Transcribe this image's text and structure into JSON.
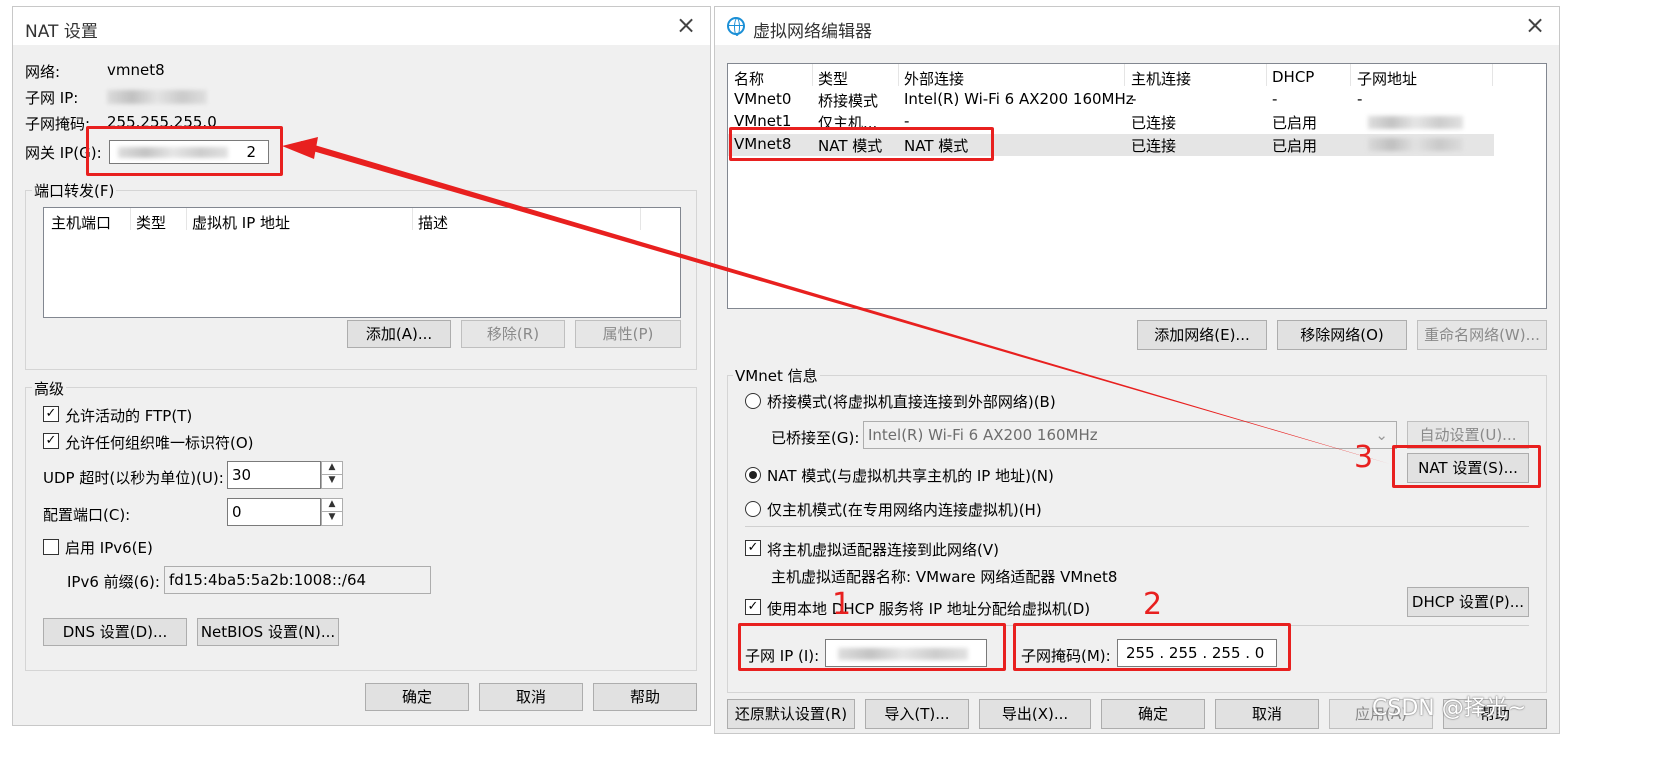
{
  "nat": {
    "title": "NAT 设置",
    "network_label": "网络:",
    "network_value": "vmnet8",
    "subnet_ip_label": "子网 IP:",
    "subnet_mask_label": "子网掩码:",
    "subnet_mask_value": "255.255.255.0",
    "gateway_label": "网关 IP(G):",
    "gateway_value": "2",
    "pf_legend": "端口转发(F)",
    "pf_columns": [
      "主机端口",
      "类型",
      "虚拟机 IP 地址",
      "描述"
    ],
    "add_btn": "添加(A)...",
    "remove_btn": "移除(R)",
    "props_btn": "属性(P)",
    "advanced_legend": "高级",
    "allow_ftp": "允许活动的 FTP(T)",
    "allow_uuid": "允许任何组织唯一标识符(O)",
    "udp_timeout_label": "UDP 超时(以秒为单位)(U):",
    "udp_timeout_value": "30",
    "config_port_label": "配置端口(C):",
    "config_port_value": "0",
    "enable_ipv6": "启用 IPv6(E)",
    "ipv6_prefix_label": "IPv6 前缀(6):",
    "ipv6_prefix_value": "fd15:4ba5:5a2b:1008::/64",
    "dns_btn": "DNS 设置(D)...",
    "netbios_btn": "NetBIOS 设置(N)...",
    "ok": "确定",
    "cancel": "取消",
    "help": "帮助"
  },
  "vne": {
    "title": "虚拟网络编辑器",
    "columns": [
      "名称",
      "类型",
      "外部连接",
      "主机连接",
      "DHCP",
      "子网地址"
    ],
    "rows": [
      {
        "name": "VMnet0",
        "type": "桥接模式",
        "ext": "Intel(R) Wi-Fi 6 AX200 160MHz",
        "host": "-",
        "dhcp": "-",
        "subnet": "-"
      },
      {
        "name": "VMnet1",
        "type": "仅主机...",
        "ext": "-",
        "host": "已连接",
        "dhcp": "已启用",
        "subnet": ""
      },
      {
        "name": "VMnet8",
        "type": "NAT 模式",
        "ext": "NAT 模式",
        "host": "已连接",
        "dhcp": "已启用",
        "subnet": ""
      }
    ],
    "add_network": "添加网络(E)...",
    "remove_network": "移除网络(O)",
    "rename_network": "重命名网络(W)...",
    "info_legend": "VMnet 信息",
    "bridged": "桥接模式(将虚拟机直接连接到外部网络)(B)",
    "bridged_to_label": "已桥接至(G):",
    "bridged_to_value": "Intel(R) Wi-Fi 6 AX200 160MHz",
    "auto_settings": "自动设置(U)...",
    "nat_mode": "NAT 模式(与虚拟机共享主机的 IP 地址)(N)",
    "nat_settings": "NAT 设置(S)...",
    "host_only": "仅主机模式(在专用网络内连接虚拟机)(H)",
    "connect_adapter": "将主机虚拟适配器连接到此网络(V)",
    "adapter_name": "主机虚拟适配器名称: VMware 网络适配器 VMnet8",
    "use_dhcp": "使用本地 DHCP 服务将 IP 地址分配给虚拟机(D)",
    "dhcp_settings": "DHCP 设置(P)...",
    "subnet_ip_label": "子网 IP (I):",
    "subnet_mask_label": "子网掩码(M):",
    "subnet_mask_value": "255 . 255 . 255 .  0",
    "restore_defaults": "还原默认设置(R)",
    "import": "导入(T)...",
    "export": "导出(X)...",
    "ok": "确定",
    "cancel": "取消",
    "apply": "应用(A)",
    "help": "帮助"
  },
  "annotations": {
    "one": "1",
    "two": "2",
    "three": "3"
  },
  "watermark": "CSDN @择光~",
  "colors": {
    "annotation_red": "#e8201f",
    "dialog_bg": "#f0f0f0",
    "selected_row": "#e5e5e5"
  }
}
